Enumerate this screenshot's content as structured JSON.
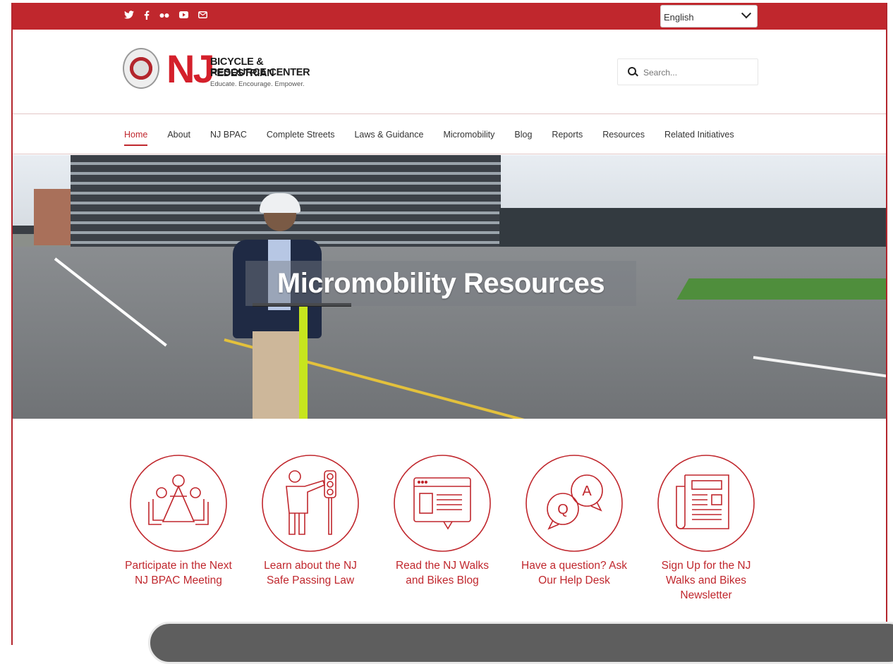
{
  "colors": {
    "brand_red": "#c0272d",
    "text_dark": "#333333"
  },
  "topbar": {
    "social_icons": [
      "twitter-icon",
      "facebook-icon",
      "flickr-icon",
      "youtube-icon",
      "email-icon"
    ],
    "language": "English"
  },
  "header": {
    "logo_mark": "NJ",
    "logo_line1": "BICYCLE & PEDESTRIAN",
    "logo_line2": "RESOURCE CENTER",
    "logo_tagline": "Educate. Encourage. Empower.",
    "search_placeholder": "Search..."
  },
  "nav": {
    "items": [
      "Home",
      "About",
      "NJ BPAC",
      "Complete Streets",
      "Laws & Guidance",
      "Micromobility",
      "Blog",
      "Reports",
      "Resources",
      "Related Initiatives"
    ],
    "active": "Home"
  },
  "hero": {
    "title": "Micromobility Resources"
  },
  "cards": [
    {
      "icon": "meeting-table-icon",
      "label": "Participate in the Next NJ BPAC Meeting"
    },
    {
      "icon": "safe-passing-icon",
      "label": "Learn about the NJ Safe Passing Law"
    },
    {
      "icon": "blog-screen-icon",
      "label": "Read the NJ Walks and Bikes Blog"
    },
    {
      "icon": "qa-bubbles-icon",
      "label": "Have a question? Ask Our Help Desk"
    },
    {
      "icon": "newspaper-icon",
      "label": "Sign Up for the NJ Walks and Bikes Newsletter"
    }
  ]
}
